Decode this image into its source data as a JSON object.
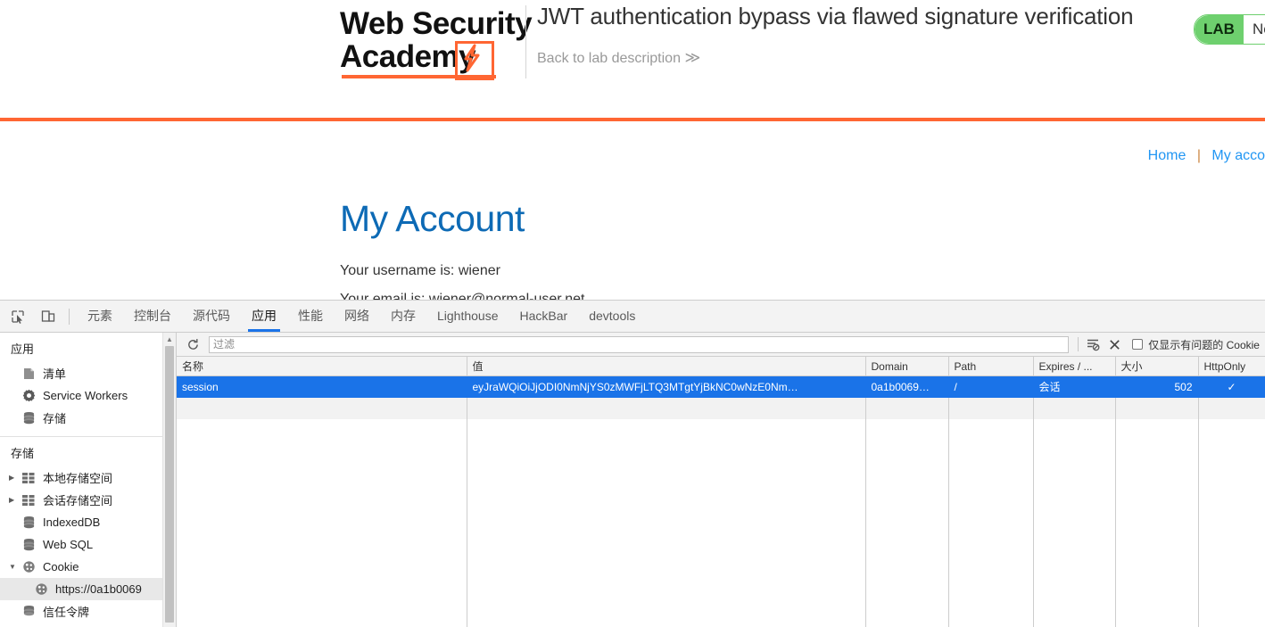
{
  "lab": {
    "logo_line1": "Web Security",
    "logo_line2": "Academy",
    "title": "JWT authentication bypass via flawed signature verification",
    "back_link": "Back to lab description",
    "back_chevron": "≫",
    "status_tag": "LAB",
    "status_state": "Not",
    "nav": {
      "home": "Home",
      "separator": "|",
      "my_account": "My acco"
    },
    "page_title": "My Account",
    "username_line": "Your username is: wiener",
    "email_line": "Your email is: wiener@normal-user.net",
    "accent_orange": "#ff6633",
    "link_blue": "#2196f3",
    "title_blue": "#0d6ab5",
    "status_green": "#6ed06e"
  },
  "devtools": {
    "tabs": [
      {
        "label": "元素",
        "active": false
      },
      {
        "label": "控制台",
        "active": false
      },
      {
        "label": "源代码",
        "active": false
      },
      {
        "label": "应用",
        "active": true
      },
      {
        "label": "性能",
        "active": false
      },
      {
        "label": "网络",
        "active": false
      },
      {
        "label": "内存",
        "active": false
      },
      {
        "label": "Lighthouse",
        "active": false
      },
      {
        "label": "HackBar",
        "active": false
      },
      {
        "label": "devtools",
        "active": false
      }
    ],
    "active_tab_color": "#1a73e8",
    "sidebar": {
      "application_title": "应用",
      "application_items": [
        {
          "label": "清单",
          "icon": "manifest-icon"
        },
        {
          "label": "Service Workers",
          "icon": "gear-icon"
        },
        {
          "label": "存储",
          "icon": "database-icon"
        }
      ],
      "storage_title": "存储",
      "storage_items": [
        {
          "label": "本地存储空间",
          "icon": "table-icon",
          "arrow": "▶"
        },
        {
          "label": "会话存储空间",
          "icon": "table-icon",
          "arrow": "▶"
        },
        {
          "label": "IndexedDB",
          "icon": "database-icon",
          "arrow": ""
        },
        {
          "label": "Web SQL",
          "icon": "database-icon",
          "arrow": ""
        },
        {
          "label": "Cookie",
          "icon": "cookie-icon",
          "arrow": "▼"
        }
      ],
      "cookie_origin": "https://0a1b0069",
      "trust_tokens": "信任令牌"
    },
    "cookie_toolbar": {
      "refresh_icon": "refresh-icon",
      "filter_placeholder": "过滤",
      "filter_value": "",
      "clear_filtered_icon": "clear-filtered-cookies-icon",
      "clear_all_icon": "close-icon",
      "only_problem_label": "仅显示有问题的 Cookie",
      "only_problem_checked": false
    },
    "cookie_table": {
      "columns": [
        "名称",
        "值",
        "Domain",
        "Path",
        "Expires / ...",
        "大小",
        "HttpOnly"
      ],
      "rows": [
        {
          "name": "session",
          "value": "eyJraWQiOiJjODI0NmNjYS0zMWFjLTQ3MTgtYjBkNC0wNzE0Nm…",
          "domain": "0a1b0069…",
          "path": "/",
          "expires": "会话",
          "size": "502",
          "httponly": "✓",
          "selected": true
        }
      ],
      "selection_color": "#1a73e8"
    }
  }
}
